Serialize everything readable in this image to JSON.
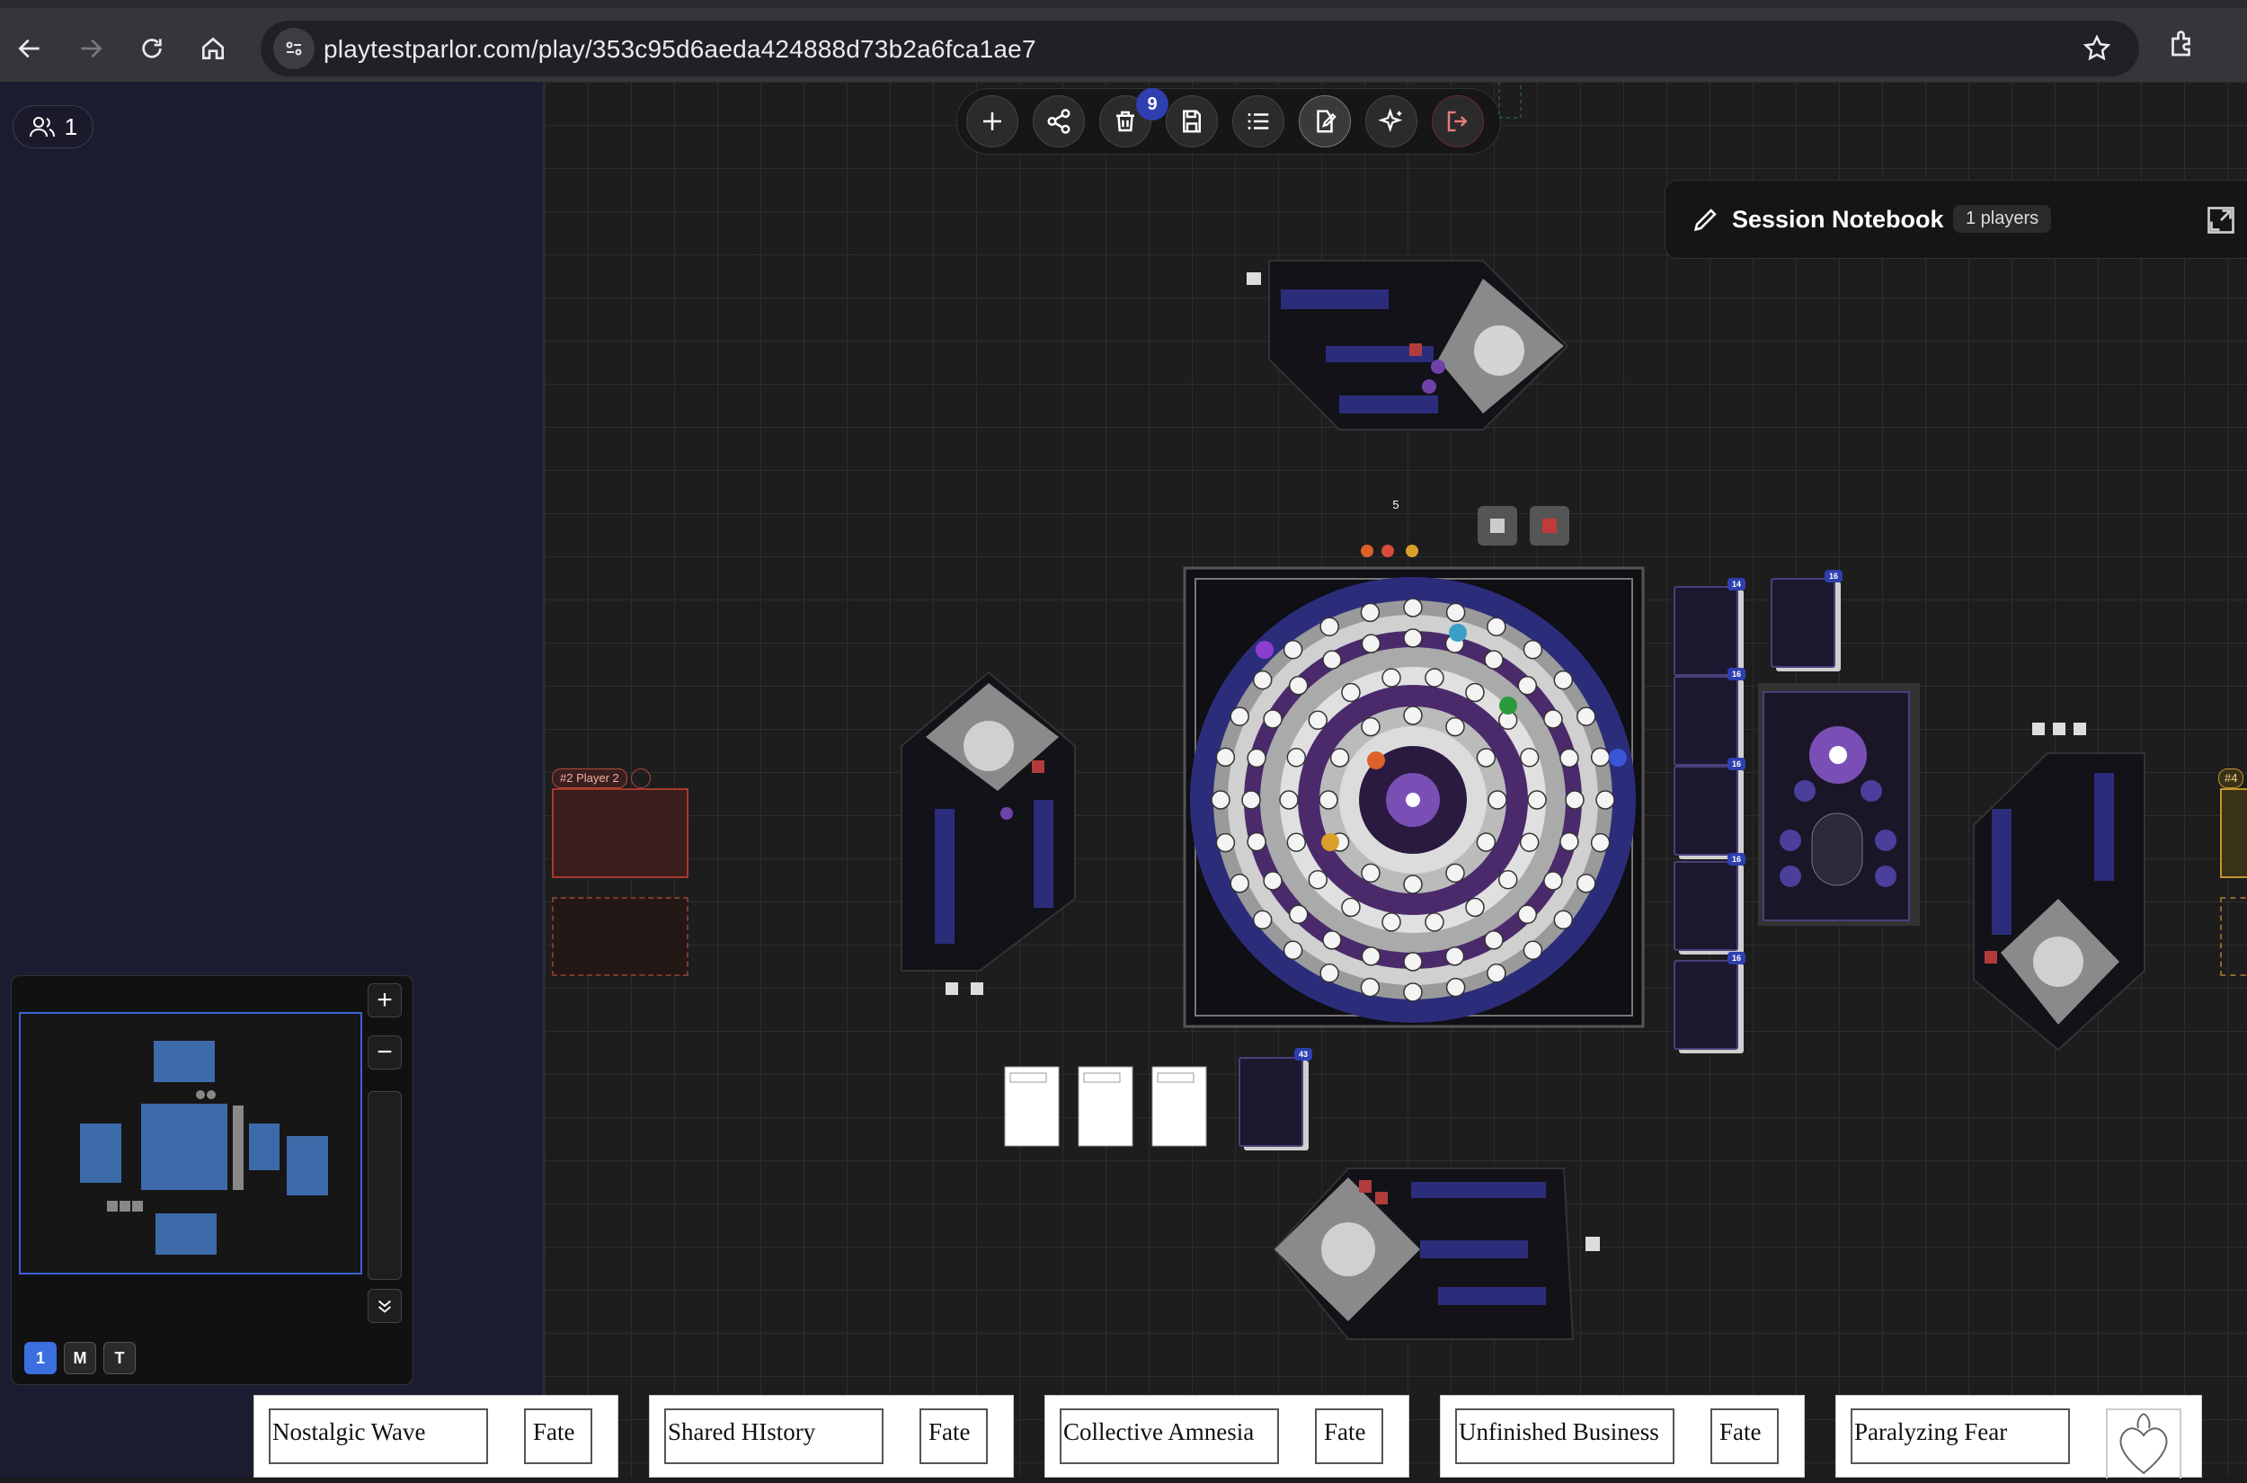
{
  "browser": {
    "url": "playtestparlor.com/play/353c95d6aeda424888d73b2a6fca1ae7",
    "icons": [
      "back-icon",
      "forward-icon",
      "reload-icon",
      "home-icon",
      "site-info-icon",
      "star-icon",
      "extensions-icon"
    ]
  },
  "players_pill": {
    "count": "1"
  },
  "toolbar": {
    "buttons": [
      "add",
      "share",
      "delete",
      "save",
      "list",
      "edit",
      "sparkle",
      "exit"
    ],
    "delete_badge": "9"
  },
  "notebook": {
    "title": "Session Notebook",
    "players": "1 players"
  },
  "board": {
    "player2_label": "#2 Player 2",
    "player4_label": "#4",
    "counter_top": "5",
    "deck_counts": [
      "14",
      "16",
      "16",
      "16",
      "16",
      "16",
      "43"
    ]
  },
  "minimap": {
    "zoom_in": "+",
    "zoom_out": "−",
    "layers": [
      "1",
      "M",
      "T"
    ]
  },
  "hand": [
    {
      "name": "Nostalgic Wave",
      "type": "Fate"
    },
    {
      "name": "Shared HIstory",
      "type": "Fate"
    },
    {
      "name": "Collective Amnesia",
      "type": "Fate"
    },
    {
      "name": "Unfinished Business",
      "type": "Fate"
    },
    {
      "name": "Paralyzing Fear",
      "type": ""
    }
  ],
  "colors": {
    "accent": "#2f3fb0",
    "board_blue": "#2c2d7a",
    "board_purple": "#4b2a6b"
  }
}
